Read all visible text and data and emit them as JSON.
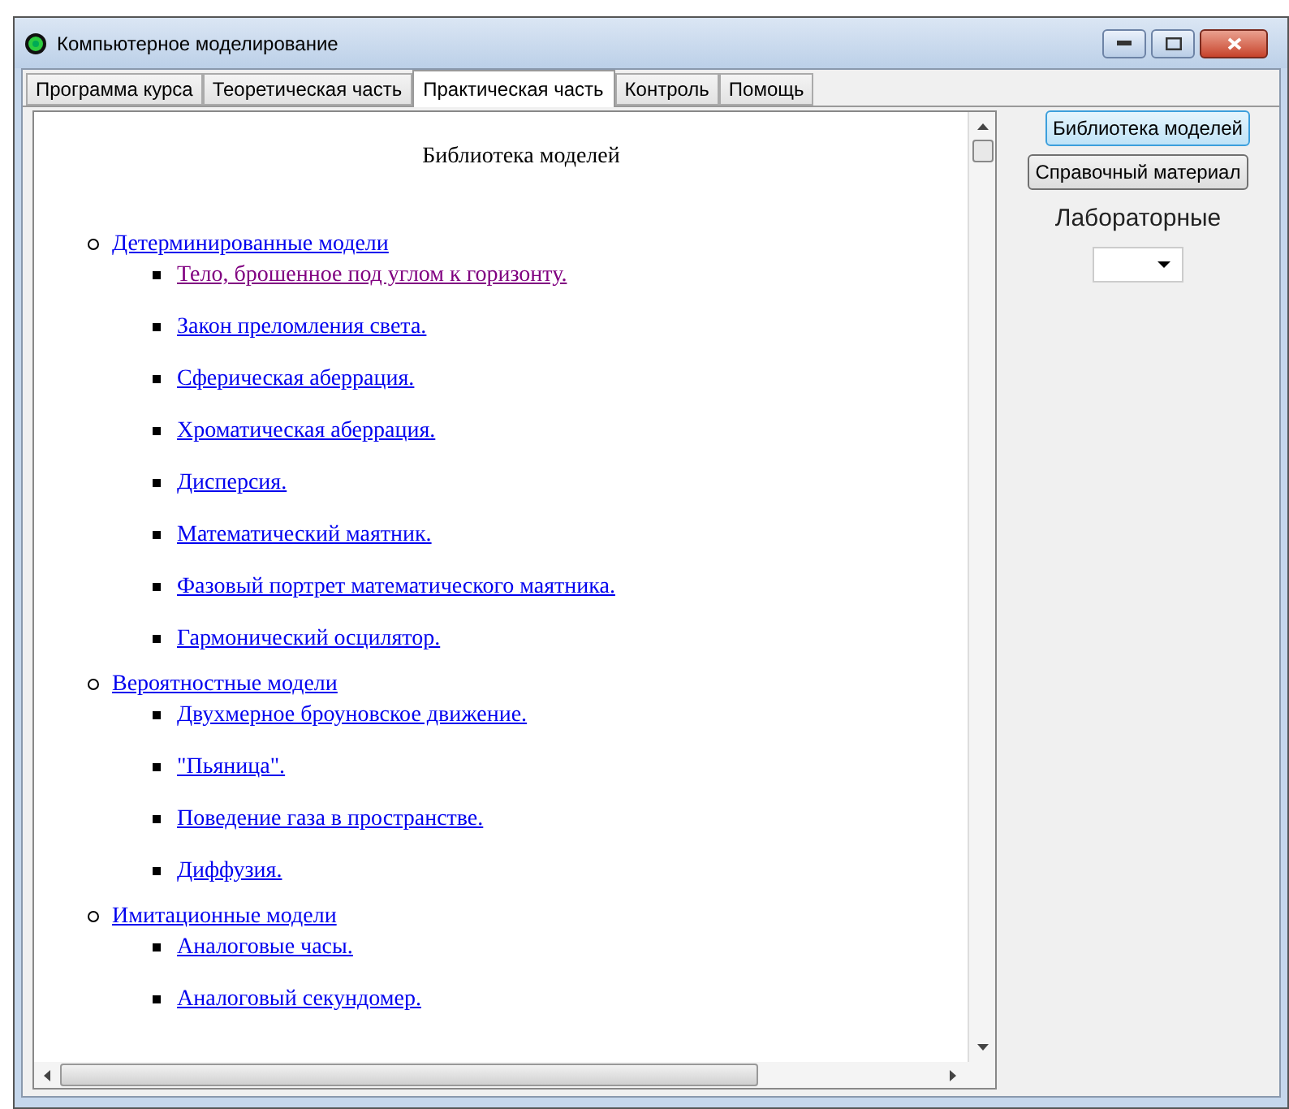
{
  "window": {
    "title": "Компьютерное моделирование"
  },
  "tabs": [
    {
      "label": "Программа курса",
      "selected": false
    },
    {
      "label": "Теоретическая часть",
      "selected": false
    },
    {
      "label": "Практическая часть",
      "selected": true
    },
    {
      "label": "Контроль",
      "selected": false
    },
    {
      "label": "Помощь",
      "selected": false
    }
  ],
  "document": {
    "heading": "Библиотека моделей",
    "groups": [
      {
        "label": "Детерминированные модели",
        "visited": false,
        "children": [
          {
            "label": "Тело, брошенное под углом к горизонту.",
            "visited": true
          },
          {
            "label": "Закон преломления света.",
            "visited": false
          },
          {
            "label": "Сферическая аберрация.",
            "visited": false
          },
          {
            "label": "Хроматическая аберрация.",
            "visited": false
          },
          {
            "label": "Дисперсия.",
            "visited": false
          },
          {
            "label": "Математический маятник.",
            "visited": false
          },
          {
            "label": "Фазовый портрет математического маятника.",
            "visited": false
          },
          {
            "label": "Гармонический осцилятор.",
            "visited": false
          }
        ]
      },
      {
        "label": "Вероятностные модели",
        "visited": false,
        "children": [
          {
            "label": "Двухмерное броуновское движение.",
            "visited": false
          },
          {
            "label": "\"Пьяница\".",
            "visited": false
          },
          {
            "label": "Поведение газа в пространстве.",
            "visited": false
          },
          {
            "label": "Диффузия.",
            "visited": false
          }
        ]
      },
      {
        "label": "Имитационные модели",
        "visited": false,
        "children": [
          {
            "label": "Аналоговые часы.",
            "visited": false
          },
          {
            "label": "Аналоговый секундомер.",
            "visited": false
          }
        ]
      }
    ]
  },
  "side_panel": {
    "buttons": [
      {
        "label": "Библиотека моделей",
        "focused": true
      },
      {
        "label": "Справочный материал",
        "focused": false
      }
    ],
    "section_label": "Лабораторные"
  }
}
